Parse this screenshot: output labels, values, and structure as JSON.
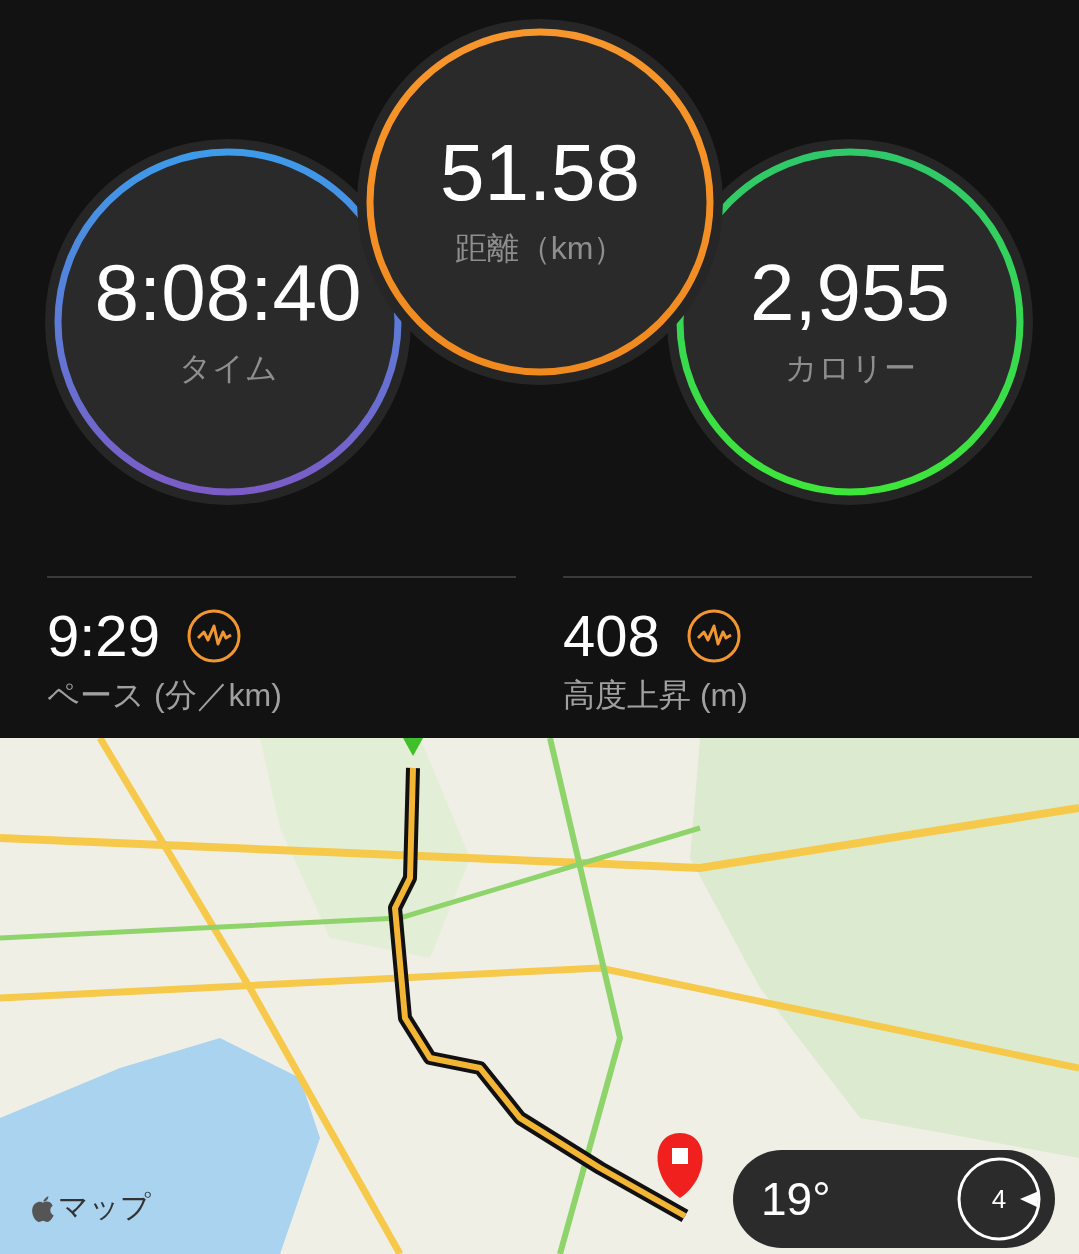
{
  "metrics": [
    {
      "kind": "time",
      "value": "8:08:40",
      "label": "タイム"
    },
    {
      "kind": "distance",
      "value": "51.58",
      "label": "距離（km）"
    },
    {
      "kind": "calories",
      "value": "2,955",
      "label": "カロリー"
    }
  ],
  "stats": [
    {
      "value": "9:29",
      "label": "ペース (分／km)"
    },
    {
      "value": "408",
      "label": "高度上昇 (m)"
    }
  ],
  "map": {
    "attribution": "マップ",
    "weather": {
      "temperature": "19°",
      "index": "4"
    }
  }
}
